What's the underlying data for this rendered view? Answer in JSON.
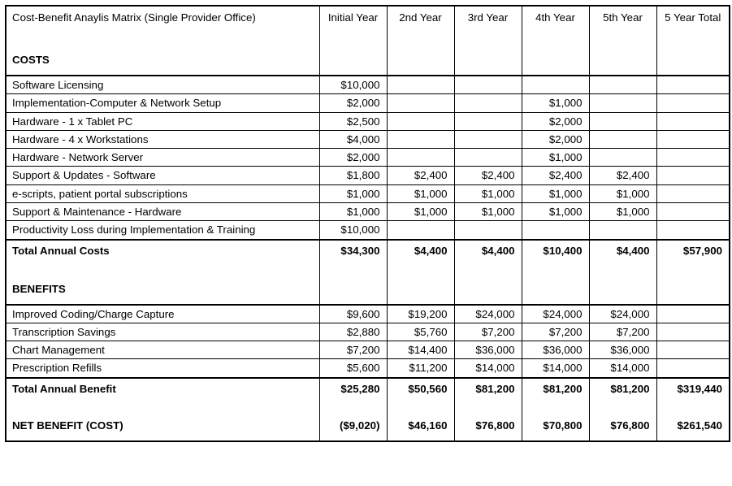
{
  "document": {
    "title": "Cost-Benefit Anaylis Matrix (Single Provider Office)",
    "type": "table"
  },
  "columns": {
    "label_header": "Cost-Benefit Anaylis Matrix (Single Provider Office)",
    "headers": [
      "Initial Year",
      "2nd Year",
      "3rd Year",
      "4th Year",
      "5th Year",
      "5 Year Total"
    ]
  },
  "sections": {
    "costs_label": "COSTS",
    "benefits_label": "BENEFITS"
  },
  "cost_rows": [
    {
      "label": "Software Licensing",
      "values": [
        "$10,000",
        "",
        "",
        "",
        "",
        ""
      ]
    },
    {
      "label": "Implementation-Computer & Network Setup",
      "values": [
        "$2,000",
        "",
        "",
        "$1,000",
        "",
        ""
      ]
    },
    {
      "label": "Hardware - 1 x Tablet PC",
      "values": [
        "$2,500",
        "",
        "",
        "$2,000",
        "",
        ""
      ]
    },
    {
      "label": "Hardware - 4 x Workstations",
      "values": [
        "$4,000",
        "",
        "",
        "$2,000",
        "",
        ""
      ]
    },
    {
      "label": "Hardware - Network Server",
      "values": [
        "$2,000",
        "",
        "",
        "$1,000",
        "",
        ""
      ]
    },
    {
      "label": "Support & Updates - Software",
      "values": [
        "$1,800",
        "$2,400",
        "$2,400",
        "$2,400",
        "$2,400",
        ""
      ]
    },
    {
      "label": "e-scripts, patient portal subscriptions",
      "values": [
        "$1,000",
        "$1,000",
        "$1,000",
        "$1,000",
        "$1,000",
        ""
      ]
    },
    {
      "label": "Support & Maintenance - Hardware",
      "values": [
        "$1,000",
        "$1,000",
        "$1,000",
        "$1,000",
        "$1,000",
        ""
      ]
    },
    {
      "label": "Productivity Loss during Implementation & Training",
      "values": [
        "$10,000",
        "",
        "",
        "",
        "",
        ""
      ]
    }
  ],
  "total_costs": {
    "label": "Total Annual Costs",
    "values": [
      "$34,300",
      "$4,400",
      "$4,400",
      "$10,400",
      "$4,400",
      "$57,900"
    ]
  },
  "benefit_rows": [
    {
      "label": "Improved Coding/Charge Capture",
      "values": [
        "$9,600",
        "$19,200",
        "$24,000",
        "$24,000",
        "$24,000",
        ""
      ]
    },
    {
      "label": "Transcription Savings",
      "values": [
        "$2,880",
        "$5,760",
        "$7,200",
        "$7,200",
        "$7,200",
        ""
      ]
    },
    {
      "label": "Chart Management",
      "values": [
        "$7,200",
        "$14,400",
        "$36,000",
        "$36,000",
        "$36,000",
        ""
      ]
    },
    {
      "label": "Prescription Refills",
      "values": [
        "$5,600",
        "$11,200",
        "$14,000",
        "$14,000",
        "$14,000",
        ""
      ]
    }
  ],
  "total_benefit": {
    "label": "Total Annual Benefit",
    "values": [
      "$25,280",
      "$50,560",
      "$81,200",
      "$81,200",
      "$81,200",
      "$319,440"
    ]
  },
  "net_benefit": {
    "label": "NET BENEFIT (COST)",
    "values": [
      "($9,020)",
      "$46,160",
      "$76,800",
      "$70,800",
      "$76,800",
      "$261,540"
    ]
  },
  "colors": {
    "border": "#000000",
    "text": "#000000",
    "background": "#ffffff"
  }
}
